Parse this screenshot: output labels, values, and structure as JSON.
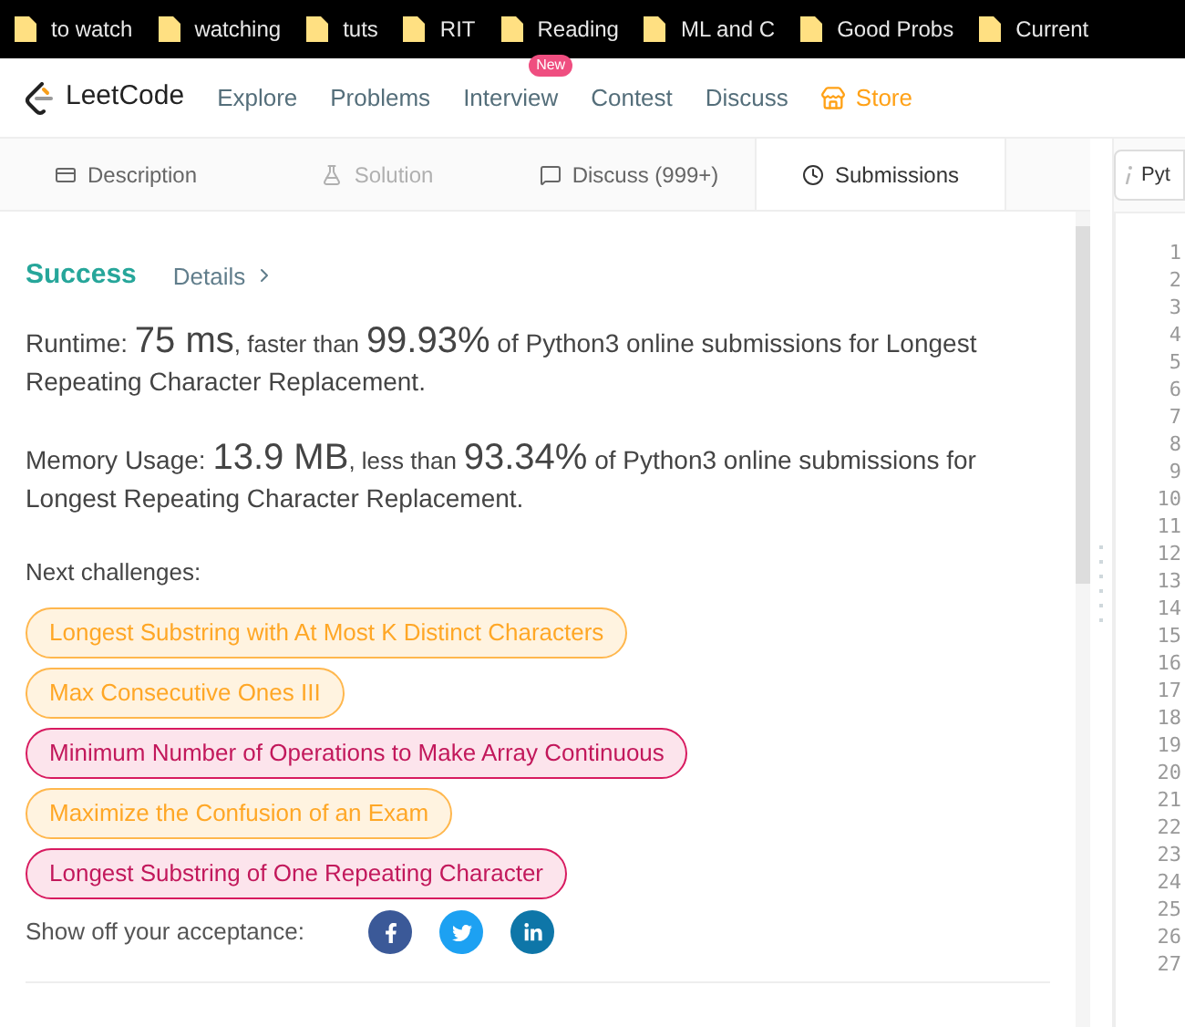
{
  "bookmarks": [
    "to watch",
    "watching",
    "tuts",
    "RIT",
    "Reading",
    "ML and C",
    "Good Probs",
    "Current"
  ],
  "nav": {
    "logo": "LeetCode",
    "items": [
      {
        "label": "Explore"
      },
      {
        "label": "Problems"
      },
      {
        "label": "Interview",
        "badge": "New"
      },
      {
        "label": "Contest"
      },
      {
        "label": "Discuss"
      }
    ],
    "store": "Store"
  },
  "tabs": [
    {
      "label": "Description",
      "selected": false,
      "disabled": false
    },
    {
      "label": "Solution",
      "selected": false,
      "disabled": true
    },
    {
      "label": "Discuss (999+)",
      "selected": false,
      "disabled": false
    },
    {
      "label": "Submissions",
      "selected": true,
      "disabled": false
    }
  ],
  "language_field": "Pyt",
  "result": {
    "status": "Success",
    "details": "Details"
  },
  "runtime": {
    "label": "Runtime:",
    "value": "75 ms",
    "middle": ", faster than",
    "percent": "99.93%",
    "rest": "of Python3 online submissions for Longest Repeating Character Replacement."
  },
  "memory": {
    "label": "Memory Usage:",
    "value": "13.9 MB",
    "middle": ", less than",
    "percent": "93.34%",
    "rest": "of Python3 online submissions for Longest Repeating Character Replacement."
  },
  "next_label": "Next challenges:",
  "challenges": [
    {
      "title": "Longest Substring with At Most K Distinct Characters",
      "kind": "medium"
    },
    {
      "title": "Max Consecutive Ones III",
      "kind": "medium"
    },
    {
      "title": "Minimum Number of Operations to Make Array Continuous",
      "kind": "hard"
    },
    {
      "title": "Maximize the Confusion of an Exam",
      "kind": "medium"
    },
    {
      "title": "Longest Substring of One Repeating Character",
      "kind": "hard"
    }
  ],
  "share_label": "Show off your acceptance:",
  "line_numbers": [
    "1",
    "2",
    "3",
    "4",
    "5",
    "6",
    "7",
    "8",
    "9",
    "10",
    "11",
    "12",
    "13",
    "14",
    "15",
    "16",
    "17",
    "18",
    "19",
    "20",
    "21",
    "22",
    "23",
    "24",
    "25",
    "26",
    "27"
  ]
}
